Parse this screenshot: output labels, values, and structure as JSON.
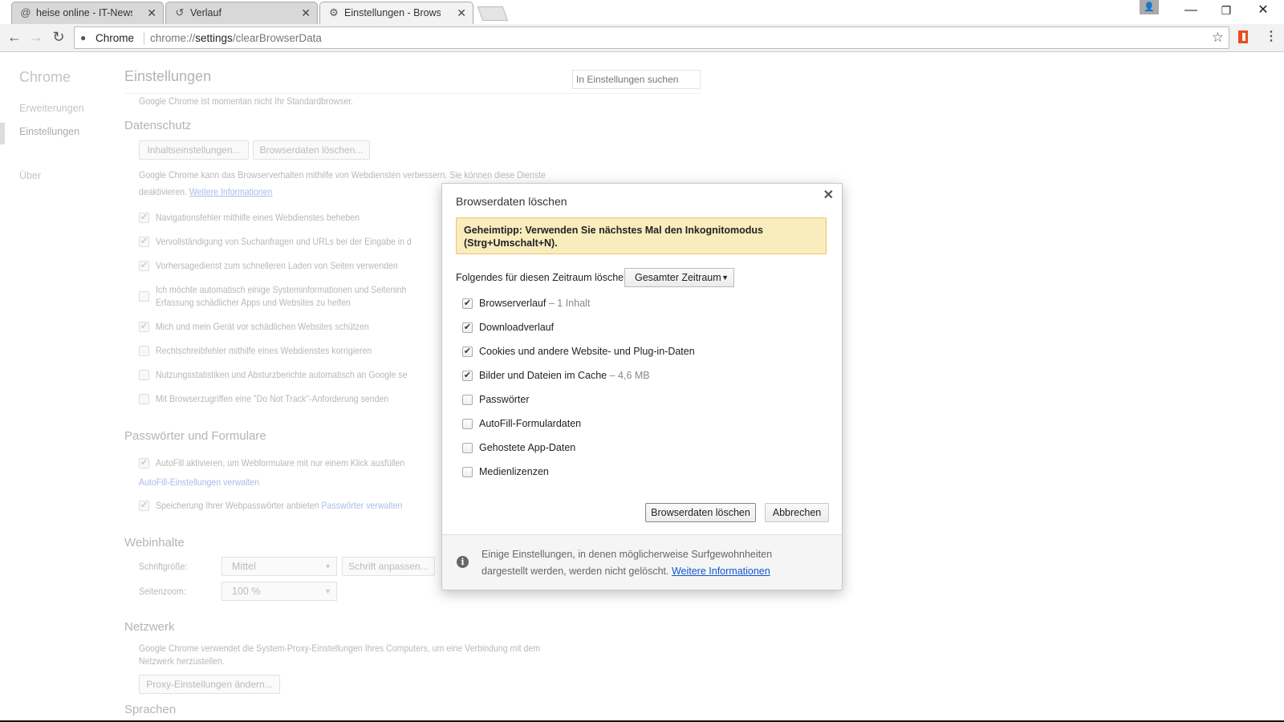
{
  "tabs": [
    {
      "icon": "heise-icon",
      "title": "heise online - IT-News, N",
      "active": false
    },
    {
      "icon": "history-icon",
      "title": "Verlauf",
      "active": false
    },
    {
      "icon": "gear-icon",
      "title": "Einstellungen - Browserd",
      "active": true
    }
  ],
  "omnibox": {
    "chip": "Chrome",
    "url_prefix": "chrome://",
    "url_host": "settings",
    "url_path": "/clearBrowserData"
  },
  "sidebar": {
    "title": "Chrome",
    "items": [
      {
        "label": "Erweiterungen"
      },
      {
        "label": "Einstellungen",
        "active": true
      },
      {
        "label": "Über"
      }
    ]
  },
  "settings": {
    "title": "Einstellungen",
    "search_placeholder": "In Einstellungen suchen",
    "default_browser_text": "Google Chrome ist momentan nicht Ihr Standardbrowser.",
    "privacy": {
      "heading": "Datenschutz",
      "content_settings_button": "Inhaltseinstellungen...",
      "clear_data_button": "Browserdaten löschen...",
      "desc_line1": "Google Chrome kann das Browserverhalten mithilfe von Webdiensten verbessern. Sie können diese Dienste",
      "desc_line2": "deaktivieren.",
      "desc_link": "Weitere Informationen",
      "options": [
        {
          "label": "Navigationsfehler mithilfe eines Webdienstes beheben",
          "checked": true
        },
        {
          "label": "Vervollständigung von Suchanfragen und URLs bei der Eingabe in d",
          "checked": true
        },
        {
          "label": "Vorhersagedienst zum schnelleren Laden von Seiten verwenden",
          "checked": true
        },
        {
          "label": "Ich möchte automatisch einige Systeminformationen und Seiteninh",
          "label2": "Erfassung schädlicher Apps und Websites zu helfen",
          "checked": false
        },
        {
          "label": "Mich und mein Gerät vor schädlichen Websites schützen",
          "checked": true
        },
        {
          "label": "Rechtschreibfehler mithilfe eines Webdienstes korrigieren",
          "checked": false
        },
        {
          "label": "Nutzungsstatistiken und Absturzberichte automatisch an Google se",
          "checked": false
        },
        {
          "label": "Mit Browserzugriffen eine \"Do Not Track\"-Anforderung senden",
          "checked": false
        }
      ]
    },
    "passwords": {
      "heading": "Passwörter und Formulare",
      "autofill_label": "AutoFill aktivieren, um Webformulare mit nur einem Klick ausfüllen",
      "autofill_link": "AutoFill-Einstellungen verwalten",
      "save_pw_label": "Speicherung Ihrer Webpasswörter anbieten",
      "save_pw_link": "Passwörter verwalten"
    },
    "web_content": {
      "heading": "Webinhalte",
      "font_size_label": "Schriftgröße:",
      "font_size_value": "Mittel",
      "customize_fonts_button": "Schrift anpassen...",
      "zoom_label": "Seitenzoom:",
      "zoom_value": "100 %"
    },
    "network": {
      "heading": "Netzwerk",
      "desc_line1": "Google Chrome verwendet die System-Proxy-Einstellungen Ihres Computers, um eine Verbindung mit dem",
      "desc_line2": "Netzwerk herzustellen.",
      "proxy_button": "Proxy-Einstellungen ändern..."
    },
    "languages": {
      "heading": "Sprachen"
    }
  },
  "dialog": {
    "title": "Browserdaten löschen",
    "tip_line1": "Geheimtipp: Verwenden Sie nächstes Mal den Inkognitomodus",
    "tip_line2": "(Strg+Umschalt+N).",
    "period_label": "Folgendes für diesen Zeitraum löschen:",
    "period_value": "Gesamter Zeitraum",
    "items": [
      {
        "label": "Browserverlauf",
        "detail": "–  1 Inhalt",
        "checked": true
      },
      {
        "label": "Downloadverlauf",
        "detail": "",
        "checked": true
      },
      {
        "label": "Cookies und andere Website- und Plug-in-Daten",
        "detail": "",
        "checked": true
      },
      {
        "label": "Bilder und Dateien im Cache",
        "detail": "–  4,6 MB",
        "checked": true
      },
      {
        "label": "Passwörter",
        "detail": "",
        "checked": false
      },
      {
        "label": "AutoFill-Formulardaten",
        "detail": "",
        "checked": false
      },
      {
        "label": "Gehostete App-Daten",
        "detail": "",
        "checked": false
      },
      {
        "label": "Medienlizenzen",
        "detail": "",
        "checked": false
      }
    ],
    "confirm_button": "Browserdaten löschen",
    "cancel_button": "Abbrechen",
    "footer_text": "Einige Einstellungen, in denen möglicherweise Surfgewohnheiten dargestellt werden, werden nicht gelöscht.",
    "footer_link": "Weitere Informationen"
  },
  "colors": {
    "tip_bg": "#f9edbe",
    "link": "#1155cc",
    "office_icon": "#e84c1c"
  }
}
